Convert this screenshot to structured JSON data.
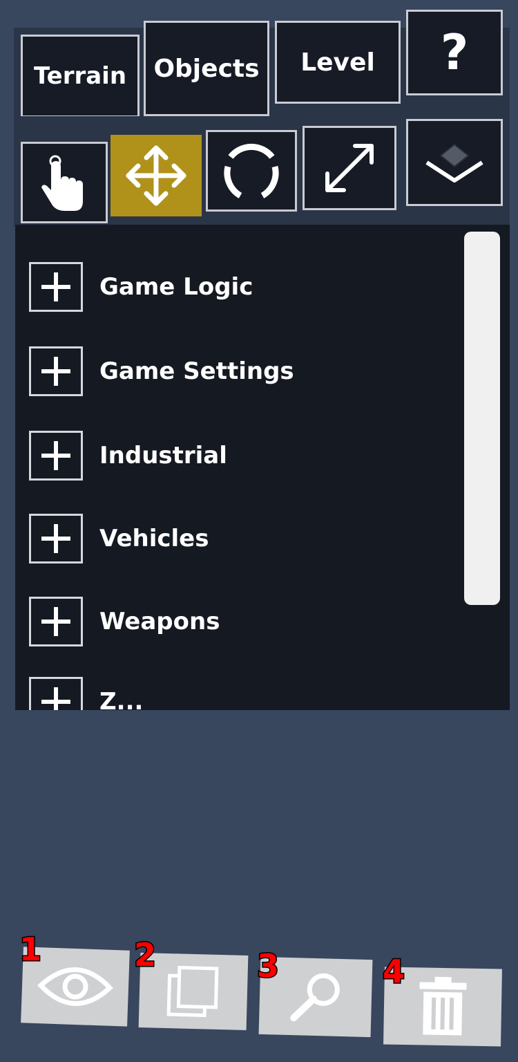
{
  "tabs": [
    {
      "label": "Terrain"
    },
    {
      "label": "Objects"
    },
    {
      "label": "Level"
    },
    {
      "label": "?"
    }
  ],
  "tools": [
    {
      "icon": "hand-pointer-icon",
      "active": false
    },
    {
      "icon": "move-arrows-icon",
      "active": true
    },
    {
      "icon": "rotate-icon",
      "active": false
    },
    {
      "icon": "scale-icon",
      "active": false
    },
    {
      "icon": "snap-layer-icon",
      "active": false
    }
  ],
  "categories": [
    {
      "label": "Game Logic"
    },
    {
      "label": "Game Settings"
    },
    {
      "label": "Industrial"
    },
    {
      "label": "Vehicles"
    },
    {
      "label": "Weapons"
    },
    {
      "label": "Z..."
    }
  ],
  "bottom_buttons": [
    {
      "number": "1",
      "icon": "eye-icon"
    },
    {
      "number": "2",
      "icon": "duplicate-icon"
    },
    {
      "number": "3",
      "icon": "search-icon"
    },
    {
      "number": "4",
      "icon": "trash-icon"
    }
  ],
  "colors": {
    "background": "#38465e",
    "active_tool": "#b0921a",
    "panel": "#151922",
    "badge": "#ff0000"
  }
}
